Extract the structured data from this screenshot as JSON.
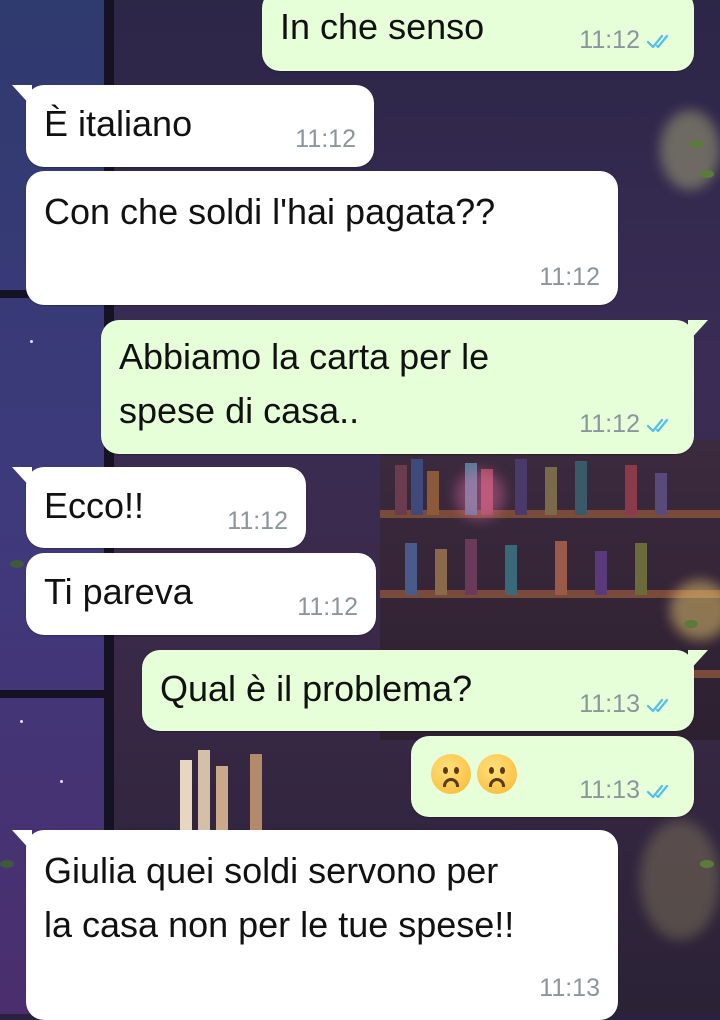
{
  "messages": [
    {
      "id": "m1",
      "direction": "out",
      "text": "In che senso",
      "time": "11:12",
      "read": true
    },
    {
      "id": "m2",
      "direction": "in",
      "text": "È italiano",
      "time": "11:12"
    },
    {
      "id": "m3",
      "direction": "in",
      "text": "Con che soldi l'hai pagata??",
      "time": "11:12"
    },
    {
      "id": "m4",
      "direction": "out",
      "text": "Abbiamo la carta per le\nspese di casa..",
      "time": "11:12",
      "read": true
    },
    {
      "id": "m5",
      "direction": "in",
      "text": "Ecco!!",
      "time": "11:12"
    },
    {
      "id": "m6",
      "direction": "in",
      "text": "Ti pareva",
      "time": "11:12"
    },
    {
      "id": "m7",
      "direction": "out",
      "text": "Qual è il problema?",
      "time": "11:13",
      "read": true
    },
    {
      "id": "m8",
      "direction": "out",
      "emojis": [
        "frowning-face",
        "frowning-face"
      ],
      "time": "11:13",
      "read": true
    },
    {
      "id": "m9",
      "direction": "in",
      "text": "Giulia quei soldi servono per\nla casa non per le tue spese!!",
      "time": "11:13"
    }
  ],
  "colors": {
    "incoming_bubble": "#ffffff",
    "outgoing_bubble": "#e6ffd9",
    "timestamp": "#8b959b",
    "read_check": "#53bdeb"
  }
}
